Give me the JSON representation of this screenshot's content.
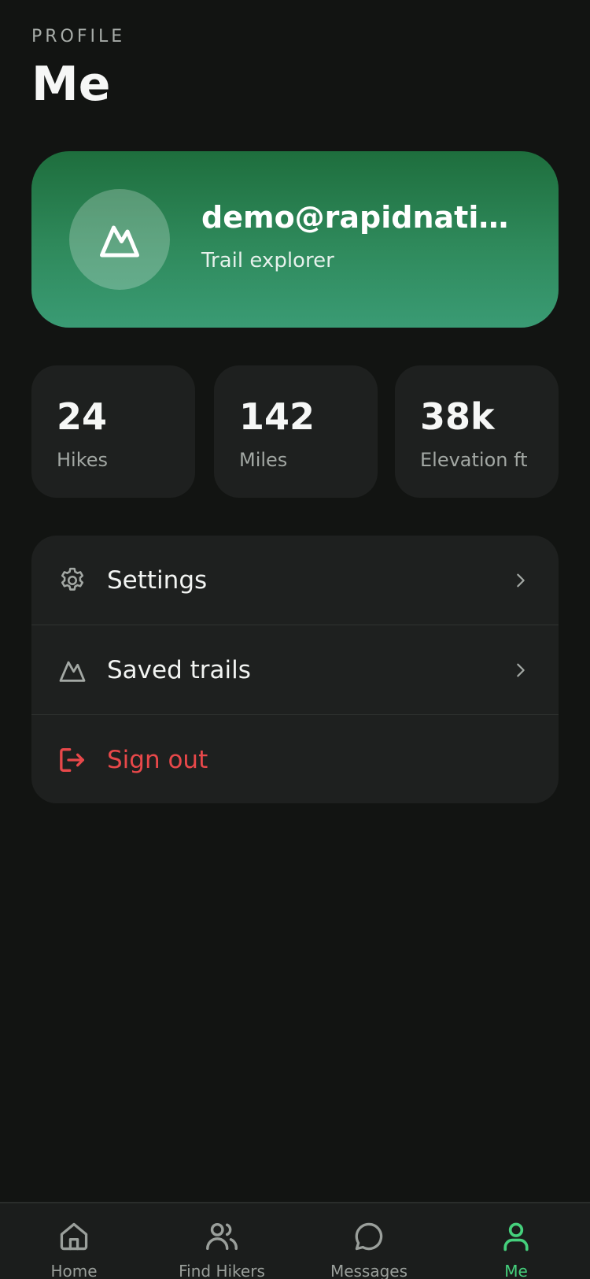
{
  "header": {
    "eyebrow": "PROFILE",
    "title": "Me"
  },
  "profile": {
    "name": "demo@rapidnativ...",
    "subtitle": "Trail explorer",
    "avatar_icon": "mountain-icon"
  },
  "stats": [
    {
      "value": "24",
      "label": "Hikes"
    },
    {
      "value": "142",
      "label": "Miles"
    },
    {
      "value": "38k",
      "label": "Elevation ft"
    }
  ],
  "menu": [
    {
      "label": "Settings",
      "icon": "gear-icon"
    },
    {
      "label": "Saved trails",
      "icon": "mountain-icon"
    },
    {
      "label": "Sign out",
      "icon": "sign-out-icon"
    }
  ],
  "tabs": [
    {
      "label": "Home",
      "icon": "home-icon",
      "active": false
    },
    {
      "label": "Find Hikers",
      "icon": "users-icon",
      "active": false
    },
    {
      "label": "Messages",
      "icon": "chat-bubble-icon",
      "active": false
    },
    {
      "label": "Me",
      "icon": "user-icon",
      "active": true
    }
  ],
  "colors": {
    "background": "#121412",
    "card": "#1e201f",
    "accent": "#45d07c",
    "danger": "#e8484a",
    "profile_gradient_top": "#1e6e3d",
    "profile_gradient_bottom": "#3a9b74"
  }
}
